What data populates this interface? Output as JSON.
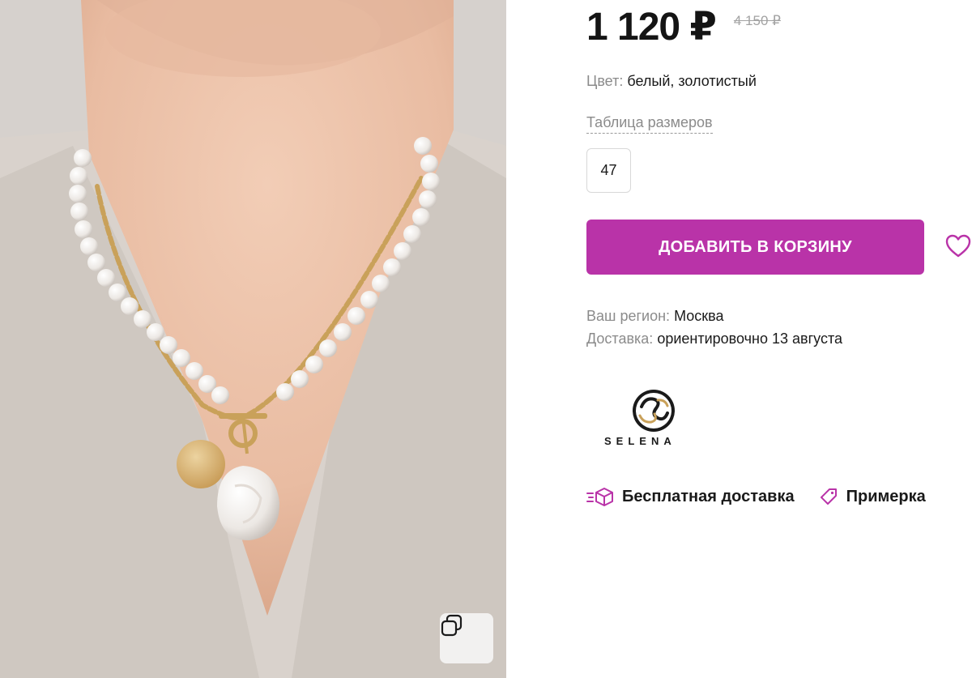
{
  "product": {
    "price": "1 120 ₽",
    "old_price": "4 150 ₽"
  },
  "color": {
    "label": "Цвет:",
    "value": "белый, золотистый"
  },
  "size_table_link": "Таблица размеров",
  "sizes": [
    "47"
  ],
  "actions": {
    "add_to_cart": "ДОБАВИТЬ В КОРЗИНУ",
    "favorite_icon": "heart-icon",
    "zoom_icon": "copy-icon"
  },
  "region": {
    "label": "Ваш регион:",
    "value": "Москва"
  },
  "delivery": {
    "label": "Доставка:",
    "value": "ориентировочно 13 августа"
  },
  "brand": {
    "name": "SELENA"
  },
  "features": [
    {
      "label": "Бесплатная доставка",
      "icon": "delivery-box-icon"
    },
    {
      "label": "Примерка",
      "icon": "tag-icon"
    }
  ],
  "colors": {
    "accent": "#b933a8",
    "muted_text": "#8b8b8b",
    "old_price": "#a3a3a3"
  }
}
